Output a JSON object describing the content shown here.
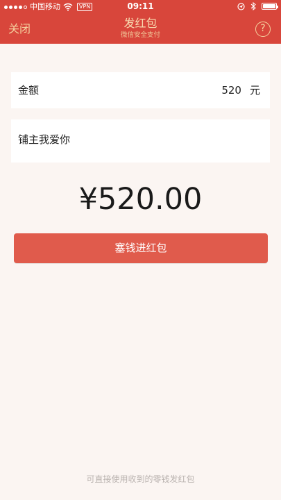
{
  "status_bar": {
    "carrier": "中国移动",
    "vpn_label": "VPN",
    "time": "09:11",
    "signal_icon": "signal-dots-icon",
    "wifi_icon": "wifi-icon",
    "location_icon": "location-icon",
    "bluetooth_icon": "bluetooth-icon",
    "battery_icon": "battery-icon"
  },
  "nav": {
    "close_label": "关闭",
    "title": "发红包",
    "subtitle": "微信安全支付",
    "help_symbol": "?"
  },
  "amount_row": {
    "label": "金额",
    "value": "520",
    "unit": "元"
  },
  "message_row": {
    "text": "铺主我爱你"
  },
  "total_display": "¥520.00",
  "send_button_label": "塞钱进红包",
  "footer_text": "可直接使用收到的零钱发红包",
  "colors": {
    "nav_bg": "#d8463b",
    "button_bg": "#e05b4c",
    "page_bg": "#fbf5f2",
    "nav_text": "#f8dab0"
  }
}
